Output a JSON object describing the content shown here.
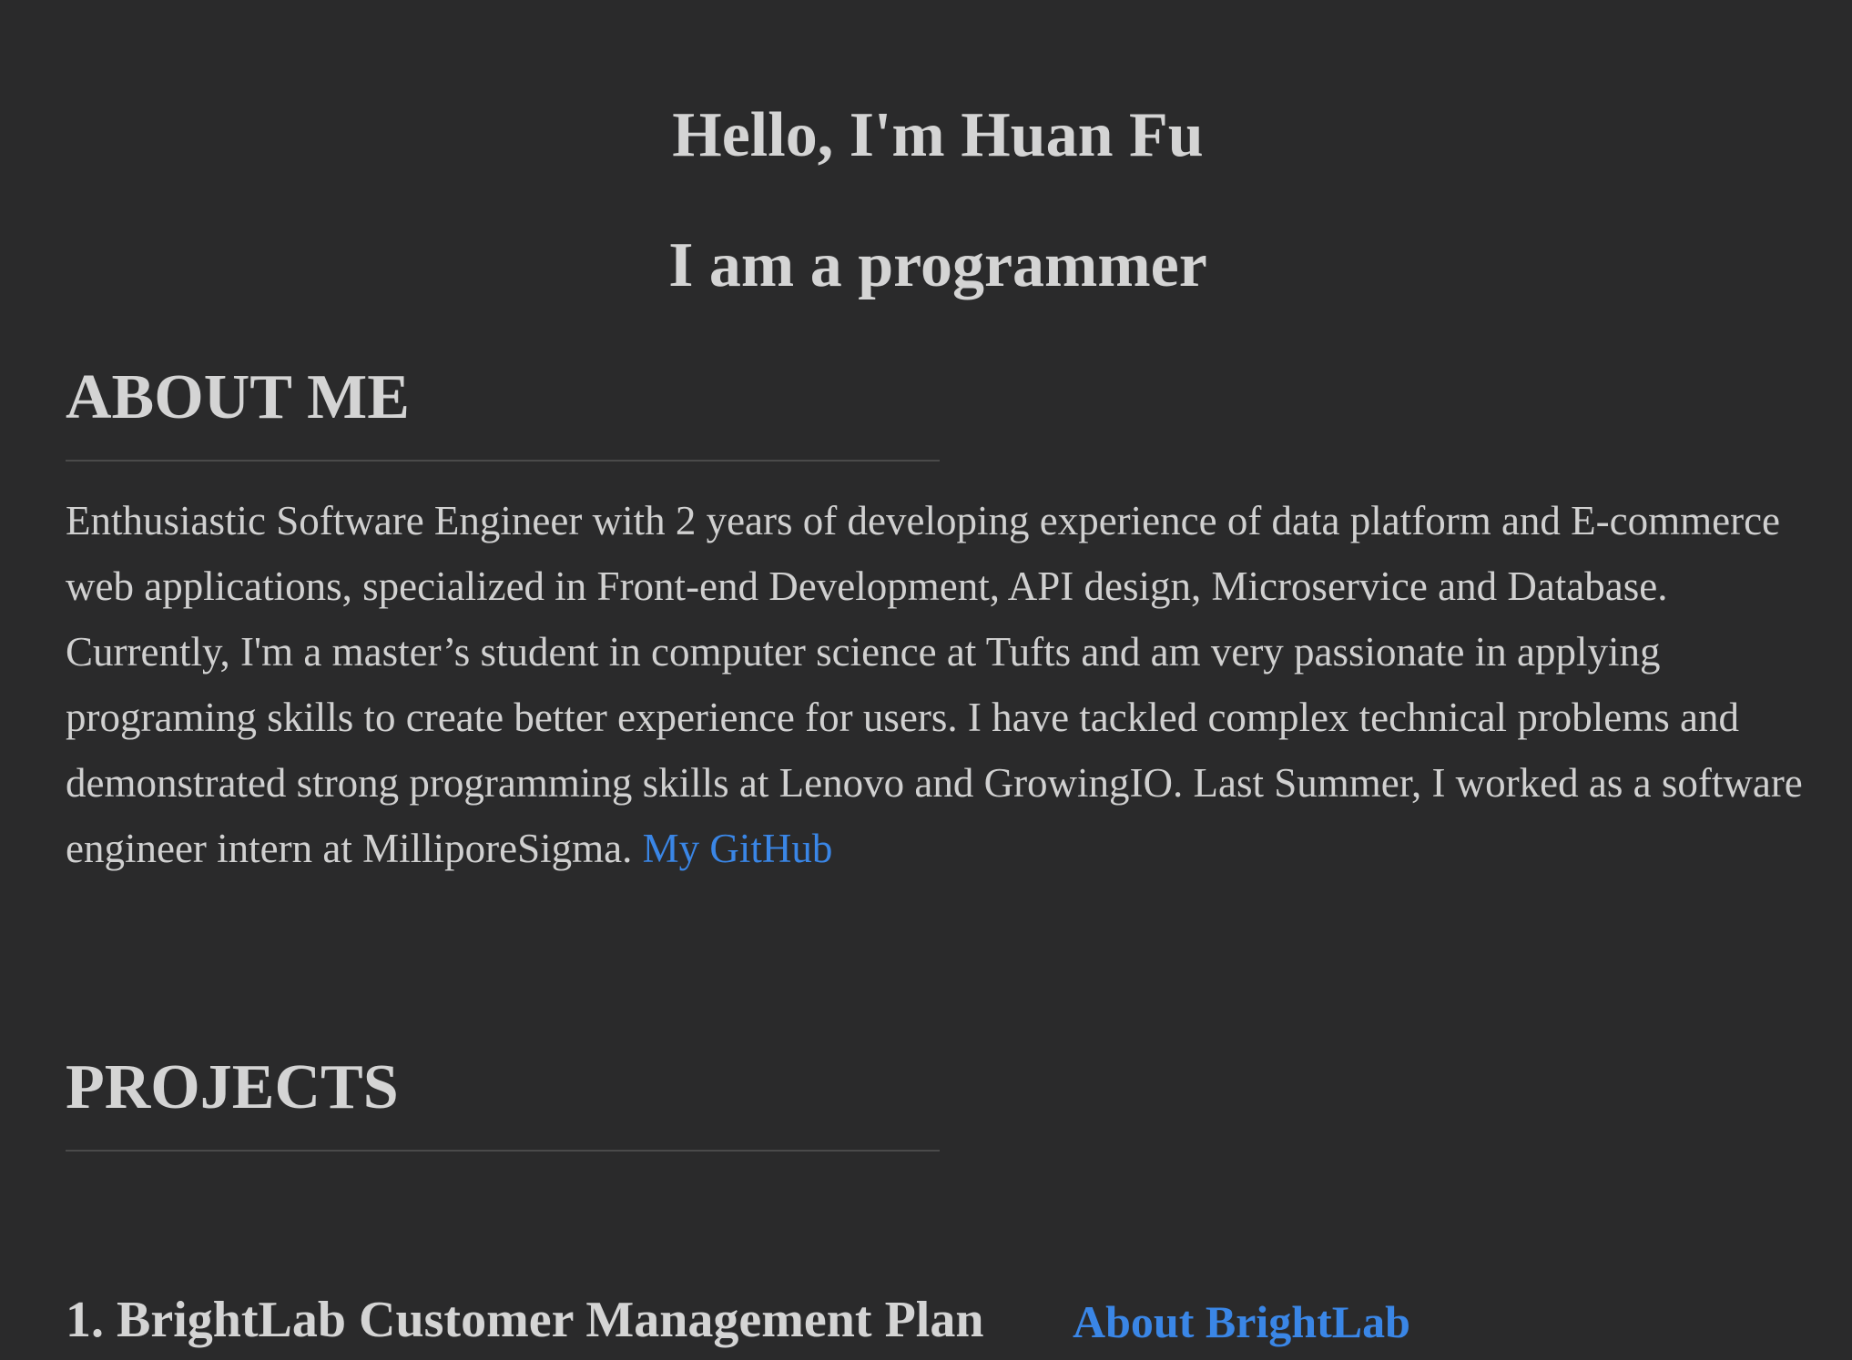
{
  "hero": {
    "greeting": "Hello, I'm Huan Fu",
    "role": "I am a programmer"
  },
  "about": {
    "heading": "ABOUT ME",
    "text": "Enthusiastic Software Engineer with 2 years of developing experience of data platform and E-commerce web applications, specialized in Front-end Development, API design, Microservice and Database. Currently, I'm a master’s student in computer science at Tufts and am very passionate in applying programing skills to create better experience for users. I have tackled complex technical problems and demonstrated strong programming skills at Lenovo and GrowingIO. Last Summer, I worked as a software engineer intern at MilliporeSigma. ",
    "github_link": "My GitHub"
  },
  "projects": {
    "heading": "PROJECTS",
    "items": [
      {
        "title": "1. BrightLab Customer Management Plan",
        "link": "About BrightLab"
      }
    ]
  },
  "colors": {
    "background": "#2a2a2b",
    "text": "#d2d2d2",
    "link": "#3a86e6",
    "divider": "#4a4a4a"
  }
}
